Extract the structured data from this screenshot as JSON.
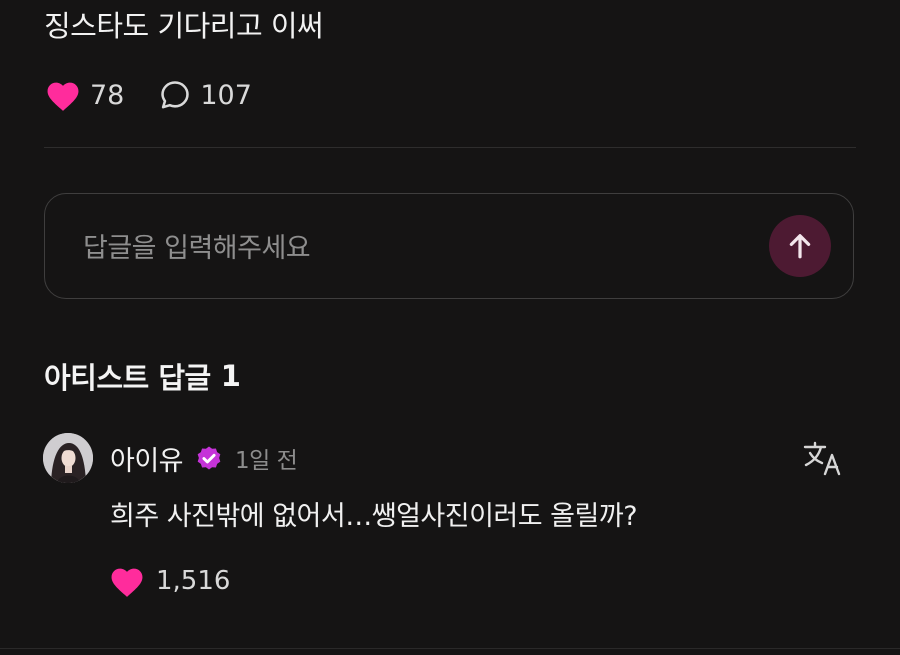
{
  "post": {
    "text": "징스타도 기다리고 이써",
    "likes": "78",
    "comments": "107"
  },
  "reply": {
    "placeholder": "답글을 입력해주세요"
  },
  "artist_replies": {
    "title": "아티스트 답글",
    "count": "1"
  },
  "comment": {
    "author": "아이유",
    "time": "1일 전",
    "text": "희주 사진밖에 없어서…쌩얼사진이러도 올릴까?",
    "likes": "1,516"
  },
  "colors": {
    "background": "#151414",
    "heart": "#ff2c9c",
    "verified_badge": "#c533d8",
    "send_button": "#4d1a32"
  },
  "icons": {
    "like": "heart-icon",
    "comment": "speech-bubble-icon",
    "send": "arrow-up-icon",
    "verified": "verified-badge-icon",
    "translate": "translate-icon"
  }
}
